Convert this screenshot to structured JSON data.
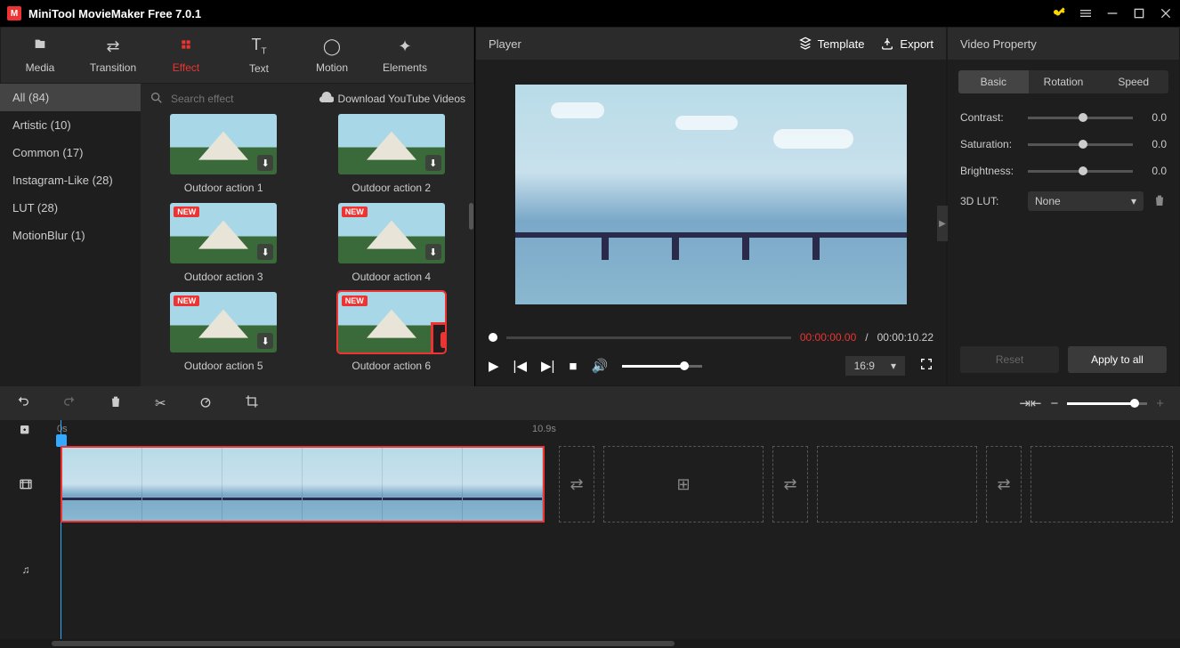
{
  "app": {
    "title": "MiniTool MovieMaker Free 7.0.1"
  },
  "toolbar": [
    {
      "label": "Media"
    },
    {
      "label": "Transition"
    },
    {
      "label": "Effect"
    },
    {
      "label": "Text"
    },
    {
      "label": "Motion"
    },
    {
      "label": "Elements"
    }
  ],
  "categories": [
    {
      "label": "All (84)"
    },
    {
      "label": "Artistic (10)"
    },
    {
      "label": "Common (17)"
    },
    {
      "label": "Instagram-Like (28)"
    },
    {
      "label": "LUT (28)"
    },
    {
      "label": "MotionBlur (1)"
    }
  ],
  "search": {
    "placeholder": "Search effect"
  },
  "download_link": "Download YouTube Videos",
  "effects": [
    {
      "name": "Outdoor action 1",
      "new": false
    },
    {
      "name": "Outdoor action 2",
      "new": false
    },
    {
      "name": "Outdoor action 3",
      "new": true
    },
    {
      "name": "Outdoor action 4",
      "new": true
    },
    {
      "name": "Outdoor action 5",
      "new": true
    },
    {
      "name": "Outdoor action 6",
      "new": true
    }
  ],
  "new_badge": "NEW",
  "player": {
    "title": "Player",
    "template": "Template",
    "export": "Export",
    "time_current": "00:00:00.00",
    "time_sep": " / ",
    "time_total": "00:00:10.22",
    "ratio": "16:9"
  },
  "property": {
    "title": "Video Property",
    "tabs": [
      "Basic",
      "Rotation",
      "Speed"
    ],
    "contrast": {
      "label": "Contrast:",
      "value": "0.0"
    },
    "saturation": {
      "label": "Saturation:",
      "value": "0.0"
    },
    "brightness": {
      "label": "Brightness:",
      "value": "0.0"
    },
    "lut": {
      "label": "3D LUT:",
      "value": "None"
    },
    "reset": "Reset",
    "apply": "Apply to all"
  },
  "timeline": {
    "mark0": "0s",
    "mark1": "10.9s"
  }
}
